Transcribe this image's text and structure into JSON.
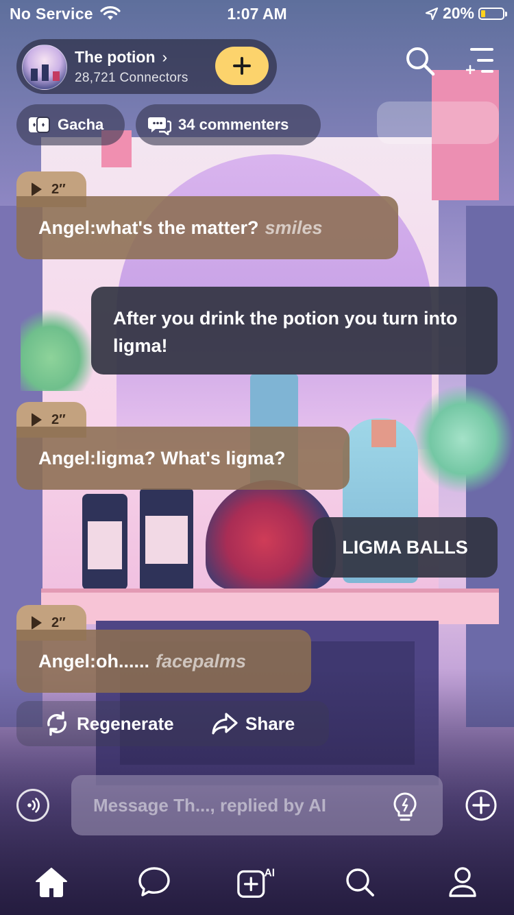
{
  "status_bar": {
    "carrier": "No Service",
    "time": "1:07 AM",
    "battery": "20%",
    "battery_level": 0.2,
    "wifi_icon": "wifi-icon",
    "location_icon": "location-arrow-icon"
  },
  "header": {
    "bot_name": "The potion",
    "bot_name_chevron": "›",
    "connectors": "28,721 Connectors",
    "follow_icon": "plus-icon",
    "search_icon": "search-icon",
    "menu_icon": "menu-icon"
  },
  "chips": {
    "gacha": "Gacha",
    "commenters": "34 commenters"
  },
  "messages": [
    {
      "role": "ai",
      "voice_duration": "2″",
      "speaker": "Angel:",
      "text": "what's the matter?",
      "action": "smiles"
    },
    {
      "role": "user",
      "text": "After you drink the potion you turn into ligma!"
    },
    {
      "role": "ai",
      "voice_duration": "2″",
      "speaker": "Angel:",
      "text": "ligma? What's ligma?",
      "action": ""
    },
    {
      "role": "user",
      "text": "LIGMA BALLS"
    },
    {
      "role": "ai",
      "voice_duration": "2″",
      "speaker": "Angel:",
      "text": "oh......",
      "action": "facepalms"
    }
  ],
  "actions": {
    "regenerate": "Regenerate",
    "share": "Share"
  },
  "input": {
    "placeholder": "Message Th..., replied by AI",
    "voice_icon": "voice-mode-icon",
    "hint_icon": "lightbulb-icon",
    "add_icon": "plus-circle-icon"
  },
  "tabbar": {
    "items": [
      "home-icon",
      "chat-bubble-icon",
      "create-ai-icon",
      "search-icon",
      "profile-icon"
    ],
    "create_badge": "AI"
  },
  "colors": {
    "accent_yellow": "#fcd36c",
    "ai_bubble": "#8c6e52",
    "voice_tag": "#c3a27f",
    "user_bubble": "#323442",
    "battery_low": "#ffd21e"
  }
}
